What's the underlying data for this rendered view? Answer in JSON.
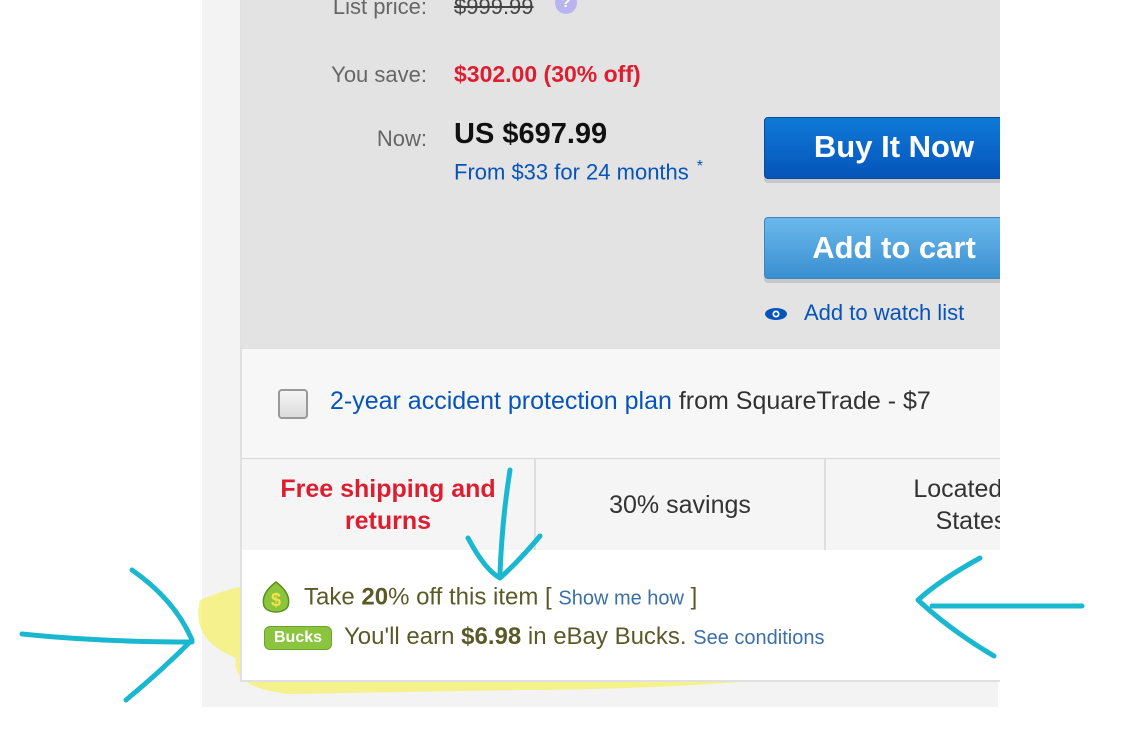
{
  "pricing": {
    "list_price_label": "List price:",
    "list_price_value": "$999.99",
    "you_save_label": "You save:",
    "you_save_value": "$302.00 (30% off)",
    "now_label": "Now:",
    "now_price": "US $697.99",
    "financing_text": "From $33 for 24 months",
    "financing_asterisk": "*"
  },
  "actions": {
    "buy_it_now": "Buy It Now",
    "add_to_cart": "Add to cart",
    "add_to_watch_list": "Add to watch list"
  },
  "protection": {
    "link_text": "2-year accident protection plan",
    "rest_text": "from SquareTrade - $7"
  },
  "features": {
    "shipping_line1": "Free shipping and",
    "shipping_line2": "returns",
    "savings": "30% savings",
    "location_line1": "Located in",
    "location_line2": "States"
  },
  "promos": {
    "take_prefix": "Take ",
    "take_percent": "20",
    "take_suffix": "% off this item [ ",
    "show_me_how": "Show me how",
    "take_close": " ]",
    "bucks_badge": "Bucks",
    "earn_prefix": "You'll earn ",
    "earn_amount": "$6.98",
    "earn_suffix": " in eBay Bucks. ",
    "see_conditions": "See conditions"
  },
  "colors": {
    "accent_blue": "#0654ba",
    "sale_red": "#dd1e31",
    "highlight_yellow": "#f5f06a",
    "annotation_cyan": "#1ab8d0"
  },
  "icons": {
    "help": "help-icon",
    "eye": "eye-icon",
    "dollar": "dollar-icon",
    "bucks": "bucks-badge-icon"
  }
}
